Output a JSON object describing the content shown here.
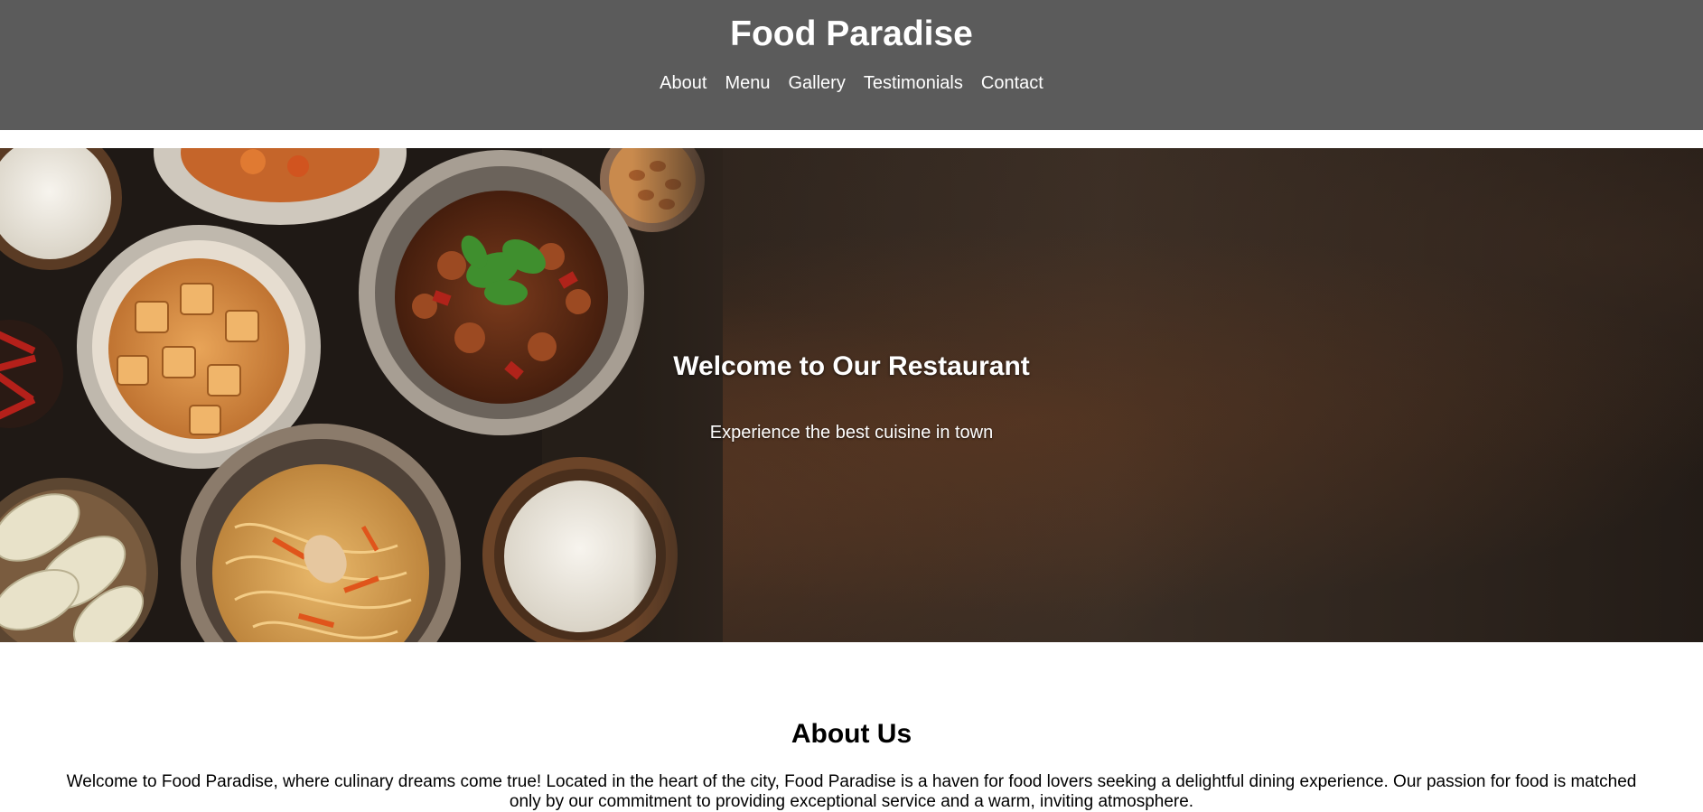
{
  "header": {
    "title": "Food Paradise",
    "nav": [
      "About",
      "Menu",
      "Gallery",
      "Testimonials",
      "Contact"
    ]
  },
  "hero": {
    "title": "Welcome to Our Restaurant",
    "subtitle": "Experience the best cuisine in town"
  },
  "about": {
    "title": "About Us",
    "text": "Welcome to Food Paradise, where culinary dreams come true! Located in the heart of the city, Food Paradise is a haven for food lovers seeking a delightful dining experience. Our passion for food is matched only by our commitment to providing exceptional service and a warm, inviting atmosphere."
  },
  "colors": {
    "header_bg": "#5b5b5b",
    "header_text": "#ffffff"
  }
}
